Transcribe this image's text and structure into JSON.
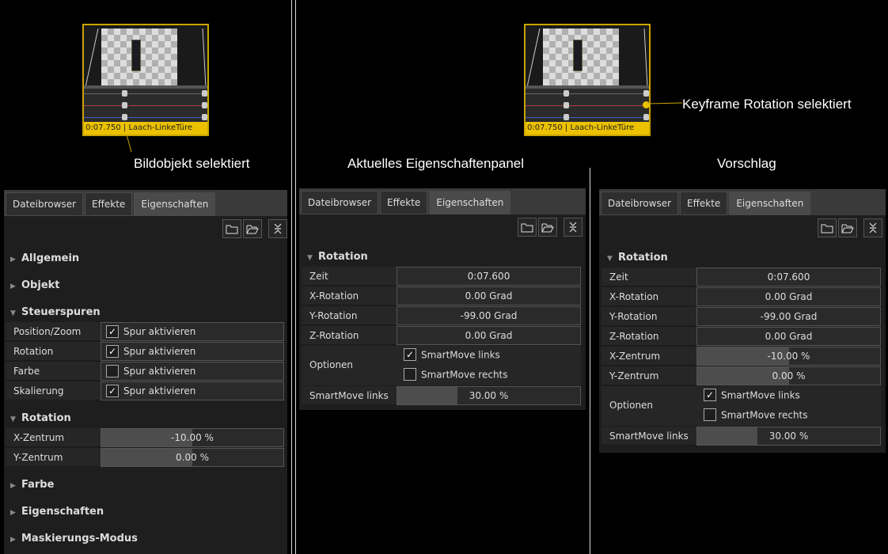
{
  "captions": {
    "left": "Bildobjekt selektiert",
    "middle": "Aktuelles Eigenschaftenpanel",
    "right": "Vorschlag",
    "keyframe": "Keyframe Rotation selektiert"
  },
  "thumbnails": [
    {
      "label": "0:07.750 | Laach-LinkeTüre"
    },
    {
      "label": "0:07.750 | Laach-LinkeTüre"
    }
  ],
  "tabs": [
    "Dateibrowser",
    "Effekte",
    "Eigenschaften"
  ],
  "left_panel": {
    "sections": {
      "allgemein": "Allgemein",
      "objekt": "Objekt",
      "steuerspuren": "Steuerspuren",
      "rotation": "Rotation",
      "farbe": "Farbe",
      "eigenschaften": "Eigenschaften",
      "maskierung": "Maskierungs-Modus"
    },
    "tracks": [
      {
        "label": "Position/Zoom",
        "value": "Spur aktivieren",
        "checked": true
      },
      {
        "label": "Rotation",
        "value": "Spur aktivieren",
        "checked": true
      },
      {
        "label": "Farbe",
        "value": "Spur aktivieren",
        "checked": false
      },
      {
        "label": "Skalierung",
        "value": "Spur aktivieren",
        "checked": true
      }
    ],
    "rotation": [
      {
        "label": "X-Zentrum",
        "value": "-10.00 %",
        "fill": 0.5
      },
      {
        "label": "Y-Zentrum",
        "value": "0.00 %",
        "fill": 0.5
      }
    ]
  },
  "middle_panel": {
    "section": "Rotation",
    "rows": [
      {
        "label": "Zeit",
        "value": "0:07.600"
      },
      {
        "label": "X-Rotation",
        "value": "0.00 Grad"
      },
      {
        "label": "Y-Rotation",
        "value": "-99.00 Grad"
      },
      {
        "label": "Z-Rotation",
        "value": "0.00 Grad"
      }
    ],
    "options": {
      "label": "Optionen",
      "opt1": "SmartMove links",
      "opt1_checked": true,
      "opt2": "SmartMove rechts",
      "opt2_checked": false
    },
    "smartmove": {
      "label": "SmartMove links",
      "value": "30.00 %",
      "fill": 0.3
    }
  },
  "right_panel": {
    "section": "Rotation",
    "rows": [
      {
        "label": "Zeit",
        "value": "0:07.600"
      },
      {
        "label": "X-Rotation",
        "value": "0.00 Grad"
      },
      {
        "label": "Y-Rotation",
        "value": "-99.00 Grad"
      },
      {
        "label": "Z-Rotation",
        "value": "0.00 Grad"
      },
      {
        "label": "X-Zentrum",
        "value": "-10.00 %",
        "fill": 0.5
      },
      {
        "label": "Y-Zentrum",
        "value": "0.00 %",
        "fill": 0.5
      }
    ],
    "options": {
      "label": "Optionen",
      "opt1": "SmartMove links",
      "opt1_checked": true,
      "opt2": "SmartMove rechts",
      "opt2_checked": false
    },
    "smartmove": {
      "label": "SmartMove links",
      "value": "30.00 %",
      "fill": 0.3
    }
  },
  "icons": {
    "folder": "folder-icon",
    "folder_open": "folder-open-icon",
    "collapse": "collapse-icon"
  },
  "colors": {
    "accent_yellow": "#ecc200",
    "panel_bg": "#1e1e1e"
  }
}
